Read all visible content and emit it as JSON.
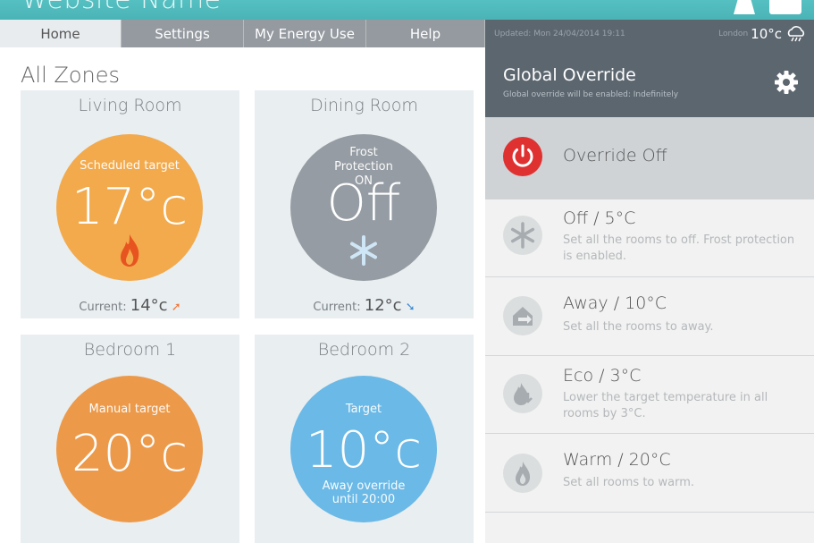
{
  "header": {
    "site_name": "Website Name"
  },
  "nav": {
    "tabs": [
      {
        "label": "Home",
        "active": true
      },
      {
        "label": "Settings",
        "active": false
      },
      {
        "label": "My Energy Use",
        "active": false
      },
      {
        "label": "Help",
        "active": false
      }
    ]
  },
  "status": {
    "updated": "Updated: Mon 24/04/2014 19:11",
    "location": "London",
    "temperature": "10°c",
    "weather_icon": "rain-cloud-icon"
  },
  "main": {
    "title": "All Zones",
    "zones": [
      {
        "name": "Living Room",
        "mode": "Scheduled target",
        "value": "17°c",
        "current_label": "Current:",
        "current": "14°c",
        "trend": "up",
        "color": "#f2aa4c",
        "icon": "flame-icon"
      },
      {
        "name": "Dining Room",
        "mode": "Frost Protection ON",
        "value": "Off",
        "current_label": "Current:",
        "current": "12°c",
        "trend": "down",
        "color": "#959ca3",
        "icon": "snowflake-icon"
      },
      {
        "name": "Bedroom 1",
        "mode": "Manual target",
        "value": "20°c",
        "color": "#ec9a4a"
      },
      {
        "name": "Bedroom 2",
        "mode": "Target",
        "value": "10°c",
        "note": "Away override until 20:00",
        "color": "#6bb9e6"
      }
    ]
  },
  "panel": {
    "title": "Global Override",
    "subtitle": "Global override will be enabled: Indefinitely",
    "options": [
      {
        "label": "Override Off",
        "desc": "",
        "icon": "power-icon",
        "active": true
      },
      {
        "label": "Off / 5°C",
        "desc": "Set all the rooms to off. Frost protection is enabled.",
        "icon": "snowflake-icon"
      },
      {
        "label": "Away / 10°C",
        "desc": "Set all the rooms to away.",
        "icon": "away-house-icon"
      },
      {
        "label": "Eco / 3°C",
        "desc": "Lower the target temperature in all rooms by 3°C.",
        "icon": "eco-flame-icon"
      },
      {
        "label": "Warm / 20°C",
        "desc": "Set all rooms to warm.",
        "icon": "flame-icon"
      }
    ]
  },
  "colors": {
    "accent": "#4ab3b6",
    "panel_dark": "#5c666f",
    "power_red": "#e03131"
  }
}
